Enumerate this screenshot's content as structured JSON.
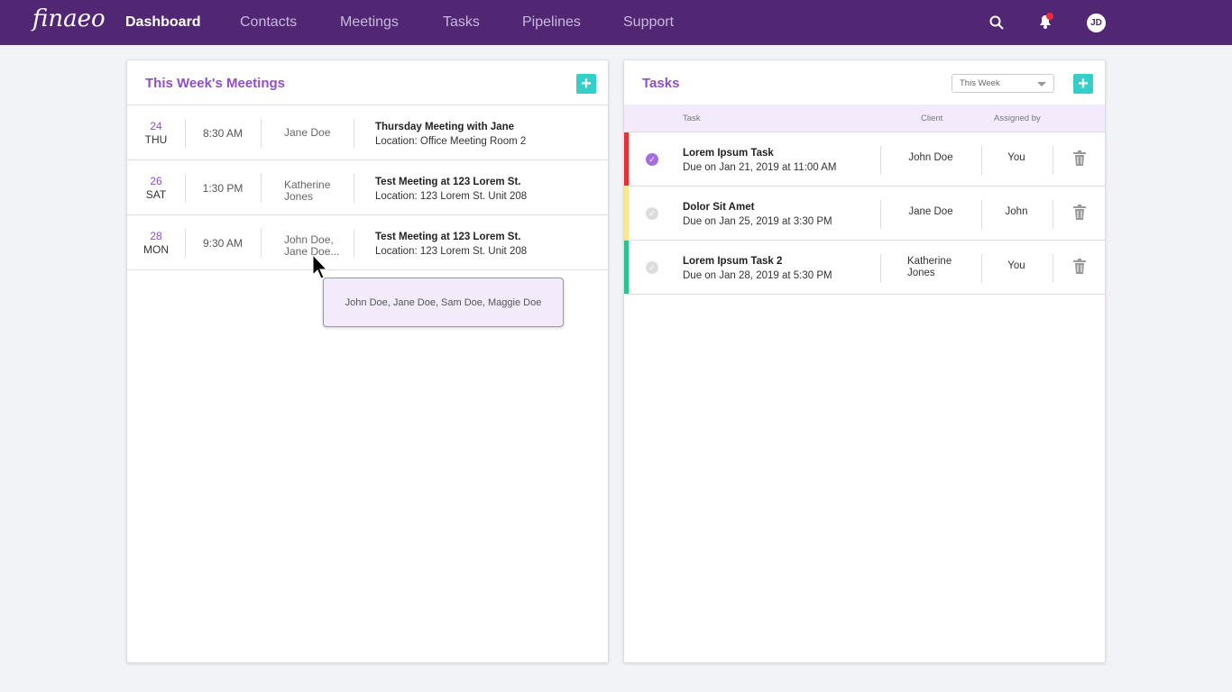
{
  "nav": {
    "logo": "finaeo",
    "links": [
      "Dashboard",
      "Contacts",
      "Meetings",
      "Tasks",
      "Pipelines",
      "Support"
    ],
    "avatar": "JD"
  },
  "meetings": {
    "title": "This Week's Meetings",
    "rows": [
      {
        "day": "24",
        "weekday": "THU",
        "time": "8:30 AM",
        "contact": "Jane Doe",
        "title": "Thursday Meeting with Jane",
        "location": "Location: Office Meeting Room 2"
      },
      {
        "day": "26",
        "weekday": "SAT",
        "time": "1:30 PM",
        "contact": "Katherine Jones",
        "title": "Test Meeting at 123 Lorem St.",
        "location": "Location: 123 Lorem St. Unit 208"
      },
      {
        "day": "28",
        "weekday": "MON",
        "time": "9:30 AM",
        "contact": "John Doe, Jane Doe...",
        "title": "Test Meeting at 123 Lorem St.",
        "location": "Location: 123 Lorem St. Unit 208"
      }
    ],
    "tooltip": "John Doe, Jane Doe, Sam Doe, Maggie Doe"
  },
  "tasks": {
    "title": "Tasks",
    "filter": "This Week",
    "columns": [
      "Task",
      "Client",
      "Assigned by"
    ],
    "rows": [
      {
        "name": "Lorem Ipsum Task",
        "due": "Due on Jan 21, 2019 at 11:00 AM",
        "client": "John Doe",
        "assigned": "You",
        "color": "#ec2d35",
        "done": true
      },
      {
        "name": "Dolor Sit Amet",
        "due": "Due on Jan 25, 2019 at 3:30 PM",
        "client": "Jane Doe",
        "assigned": "John",
        "color": "#fde58a",
        "done": false
      },
      {
        "name": "Lorem Ipsum Task 2",
        "due": "Due on Jan 28, 2019 at 5:30 PM",
        "client": "Katherine Jones",
        "assigned": "You",
        "color": "#27c48f",
        "done": false
      }
    ]
  }
}
